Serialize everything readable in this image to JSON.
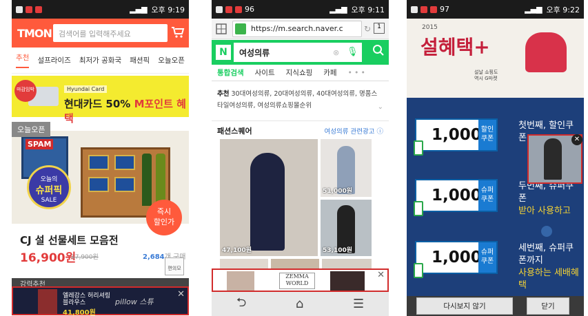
{
  "phone1": {
    "status": {
      "time": "오후 9:19"
    },
    "header": {
      "logo": "TMON",
      "search_placeholder": "검색어를 입력해주세요"
    },
    "tabs": [
      "추천",
      "설프라이즈",
      "최저가 공화국",
      "패션픽",
      "오늘오픈"
    ],
    "banner": {
      "tag": "마감임박",
      "card_label": "Hyundai Card",
      "text_prefix": "현대카드 50% ",
      "text_highlight": "M포인트 혜택"
    },
    "deal_badge": "오늘오픈",
    "product_image": {
      "spam_label": "SPAM",
      "sale_line1": "오늘의",
      "sale_big": "슈퍼픽",
      "sale_line2": "SALE"
    },
    "open_circle": {
      "line1": "즉시",
      "line2": "할인가"
    },
    "product": {
      "title": "CJ 설 선물세트 모음전",
      "price": "16,900원",
      "orig_price": "17,900원",
      "count": "2,684",
      "count_suffix": "개 구매"
    },
    "convenience_btn": "편의모",
    "next_section": "강력추천",
    "ad": {
      "line1": "엘레강스 허리셔링",
      "line2": "블라우스",
      "price": "41,800원",
      "brand": "pillow 스튜"
    }
  },
  "phone2": {
    "status": {
      "time": "오후 9:11",
      "extra": "96"
    },
    "browser": {
      "url": "https://m.search.naver.c"
    },
    "naver": {
      "logo": "N",
      "query": "여성의류"
    },
    "tabs": [
      "통합검색",
      "사이트",
      "지식쇼핑",
      "카페"
    ],
    "recommend": {
      "label": "추천",
      "text": "30대여성의류, 20대여성의류, 40대여성의류, 명품스타일여성의류, 여성의류쇼핑몰순위"
    },
    "fashion": {
      "title": "패션스퀘어",
      "link": "여성의류 관련광고 ⓘ"
    },
    "prices": [
      "47,100원",
      "51,000원",
      "53,100원"
    ],
    "ad": {
      "brand_line1": "ZEMMA",
      "brand_line2": "WORLD"
    }
  },
  "phone3": {
    "status": {
      "time": "오후 9:22",
      "extra": "97"
    },
    "header": {
      "year": "2015",
      "title": "설혜택+",
      "sub_line1": "설날 쇼핑도",
      "sub_line2": "역시 G마켓"
    },
    "coupons": [
      {
        "amount": "1,000",
        "label": "할인쿠폰",
        "text1": "첫번째, 할인쿠폰",
        "text2": "",
        "highlight": ""
      },
      {
        "amount": "1,000",
        "label": "슈퍼쿠폰",
        "text1": "두번째, 슈퍼쿠폰",
        "text2": "",
        "highlight": "받아 사용하고"
      },
      {
        "amount": "1,000",
        "label": "슈퍼쿠폰",
        "text1": "세번째, 슈퍼쿠폰까지",
        "text2": "",
        "highlight": "사용하는 세배혜택"
      }
    ],
    "buttons": {
      "hide": "다시보지 않기",
      "close": "닫기"
    }
  }
}
